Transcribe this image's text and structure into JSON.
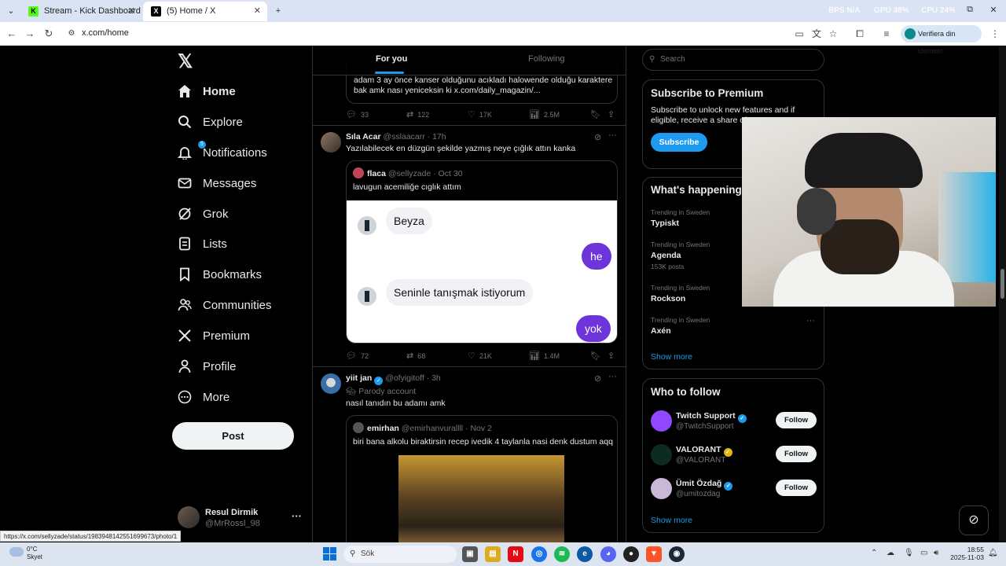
{
  "browser": {
    "tabs": [
      {
        "title": "Stream - Kick Dashboard",
        "favicon": "K"
      },
      {
        "title": "(5) Home / X",
        "favicon": "X"
      }
    ],
    "url": "x.com/home",
    "overlay_stats": {
      "bps": "BPS N/A",
      "gpu": "GPU 38%",
      "cpu": "CPU 24%"
    },
    "profile_button": "Verifiera din identitet",
    "status_url": "https://x.com/sellyzade/status/1983948142551699673/photo/1"
  },
  "sidebar": {
    "items": [
      {
        "label": "Home",
        "icon": "home-icon"
      },
      {
        "label": "Explore",
        "icon": "search-icon"
      },
      {
        "label": "Notifications",
        "icon": "bell-icon",
        "badge": "5"
      },
      {
        "label": "Messages",
        "icon": "mail-icon"
      },
      {
        "label": "Grok",
        "icon": "grok-icon"
      },
      {
        "label": "Lists",
        "icon": "list-icon"
      },
      {
        "label": "Bookmarks",
        "icon": "bookmark-icon"
      },
      {
        "label": "Communities",
        "icon": "people-icon"
      },
      {
        "label": "Premium",
        "icon": "x-icon"
      },
      {
        "label": "Profile",
        "icon": "person-icon"
      },
      {
        "label": "More",
        "icon": "more-circle-icon"
      }
    ],
    "post_label": "Post",
    "account": {
      "name": "Resul Dirmik",
      "handle": "@MrRossl_98"
    }
  },
  "feed": {
    "tabs": [
      "For you",
      "Following"
    ],
    "top_quote": {
      "text_line1": "adam 3 ay önce kanser olduğunu acıkladı halowende olduğu karaktere",
      "text_line2": "bak amk nası yeniceksin ki x.com/daily_magazin/..."
    },
    "top_actions": {
      "replies": "33",
      "reposts": "122",
      "likes": "17K",
      "views": "2.5M"
    },
    "tweet1": {
      "name": "Sıla Acar",
      "meta": "@sslaacarr · 17h",
      "text": "Yazılabilecek en düzgün şekilde yazmış neye çığlık attın kanka",
      "quote": {
        "name": "flaca",
        "meta": "@sellyzade · Oct 30",
        "text": "lavugun acemiliğe cıglık attım",
        "chat": [
          {
            "side": "left",
            "text": "Beyza"
          },
          {
            "side": "right",
            "text": "he"
          },
          {
            "side": "left",
            "text": "Seninle tanışmak istiyorum"
          },
          {
            "side": "right",
            "text": "yok"
          }
        ]
      },
      "actions": {
        "replies": "72",
        "reposts": "68",
        "likes": "21K",
        "views": "1.4M"
      }
    },
    "tweet2": {
      "name": "yiit jan",
      "meta": "@ofyigitoff · 3h",
      "label": "Parody account",
      "text": "nasıl tanıdın bu adamı amk",
      "quote": {
        "name": "emirhan",
        "meta": "@emirhanvurallll · Nov 2",
        "text": "biri bana alkolu biraktirsin recep ivedik 4 taylanla nasi denk dustum aqq"
      }
    }
  },
  "right": {
    "search_placeholder": "Search",
    "premium": {
      "title": "Subscribe to Premium",
      "desc": "Subscribe to unlock new features and if eligible, receive a share of",
      "button": "Subscribe"
    },
    "happening": {
      "title": "What's happening",
      "trends": [
        {
          "context": "Trending in Sweden",
          "topic": "Typiskt",
          "posts": ""
        },
        {
          "context": "Trending in Sweden",
          "topic": "Agenda",
          "posts": "153K posts"
        },
        {
          "context": "Trending in Sweden",
          "topic": "Rockson",
          "posts": ""
        },
        {
          "context": "Trending in Sweden",
          "topic": "Axén",
          "posts": ""
        }
      ],
      "show_more": "Show more"
    },
    "who_to_follow": {
      "title": "Who to follow",
      "users": [
        {
          "name": "Twitch Support",
          "handle": "@TwitchSupport",
          "color": "#9146ff"
        },
        {
          "name": "VALORANT",
          "handle": "@VALORANT",
          "color": "#0d2c1f"
        },
        {
          "name": "Ümit Özdağ",
          "handle": "@umitozdag",
          "color": "#c9b8d6"
        }
      ],
      "follow_label": "Follow",
      "show_more": "Show more"
    }
  },
  "taskbar": {
    "weather_temp": "0°C",
    "weather_desc": "Skyet",
    "search_placeholder": "Sök",
    "time": "18:55",
    "date": "2025-11-03"
  }
}
